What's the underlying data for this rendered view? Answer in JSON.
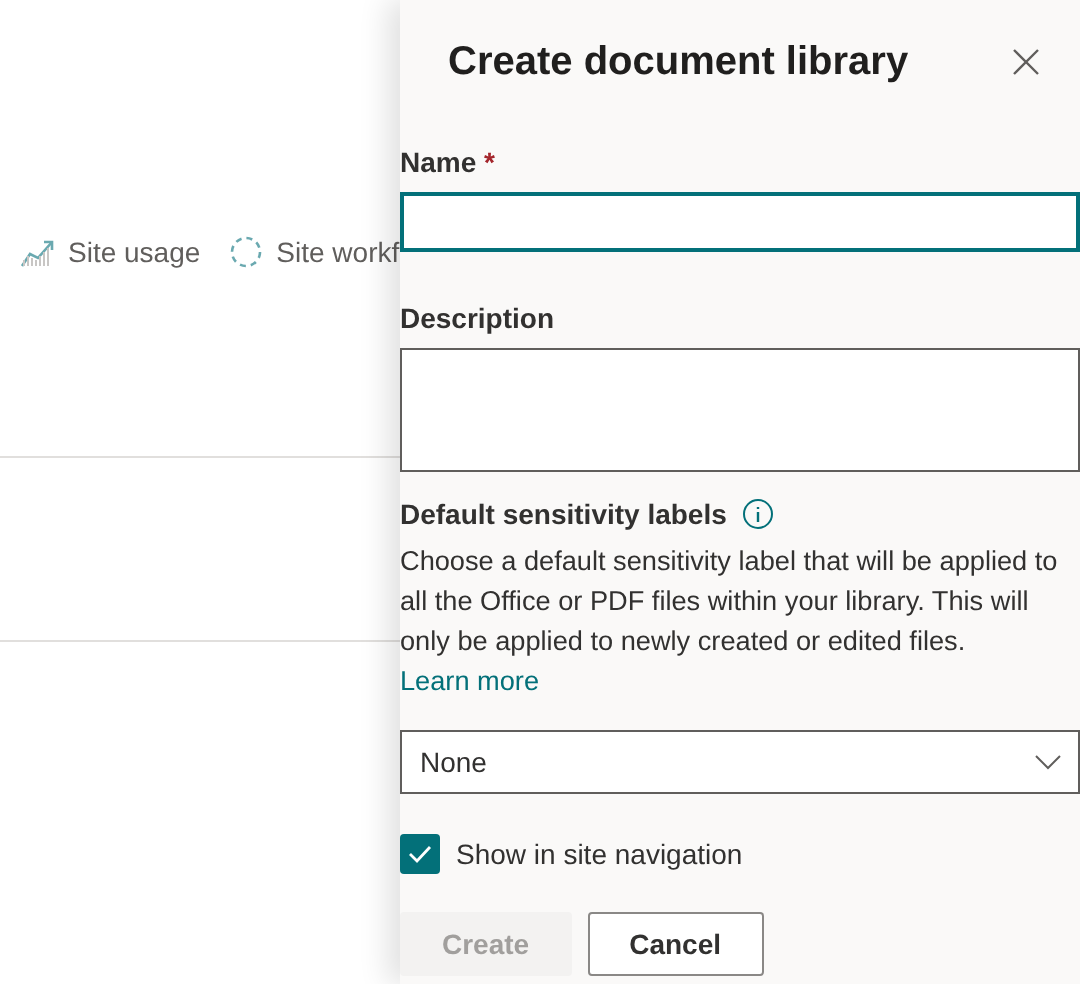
{
  "page": {
    "toolbar": [
      {
        "label": "Site usage",
        "kind": "usage"
      },
      {
        "label": "Site workf",
        "kind": "workflow"
      }
    ]
  },
  "panel": {
    "title": "Create document library",
    "name_field": {
      "label": "Name",
      "required_mark": "*"
    },
    "description_field": {
      "label": "Description"
    },
    "sensitivity": {
      "label": "Default sensitivity labels",
      "text": "Choose a default sensitivity label that will be applied to all the Office or PDF files within your library. This will only be applied to newly created or edited files.",
      "link": "Learn more",
      "dropdown": "None"
    },
    "show_in_navigation": {
      "label": "Show in site navigation",
      "checked": true
    },
    "buttons": [
      {
        "label": "Create",
        "kind": "primary",
        "disabled": true
      },
      {
        "label": "Cancel",
        "kind": "default",
        "disabled": false
      }
    ]
  }
}
